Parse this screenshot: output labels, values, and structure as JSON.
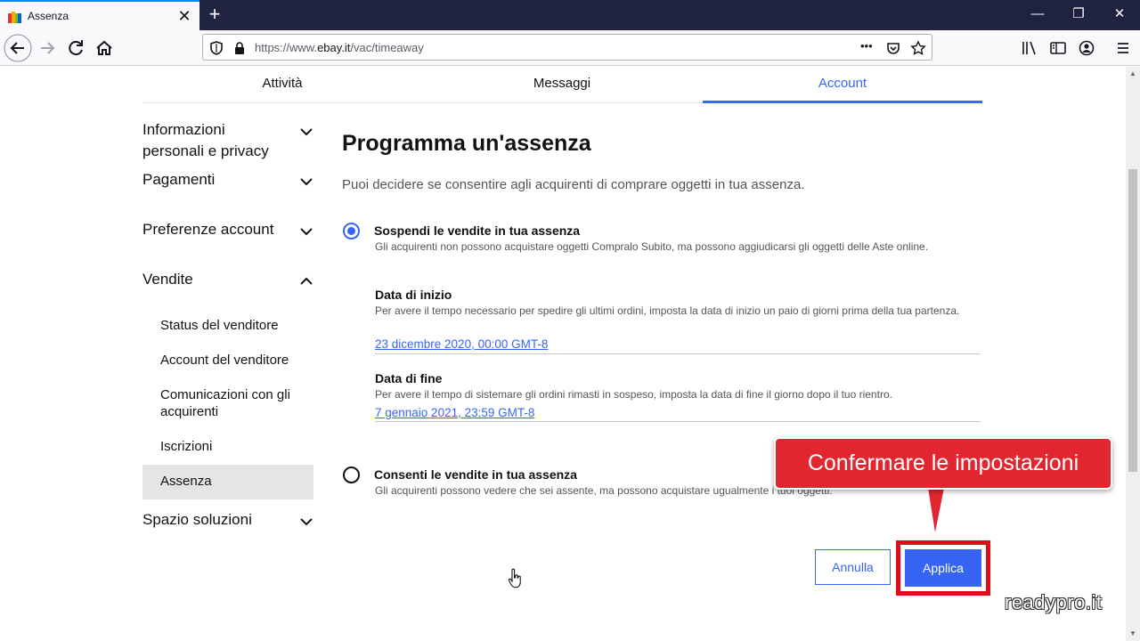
{
  "browser": {
    "tab_title": "Assenza",
    "tab_close": "✕",
    "new_tab": "+",
    "url_prefix": "https://www.",
    "url_domain": "ebay.it",
    "url_path": "/vac/timeaway",
    "url_more": "•••",
    "window_minimize": "—",
    "window_restore": "❐",
    "window_close": "✕",
    "icons": [
      "back-icon",
      "forward-icon",
      "reload-icon",
      "home-icon",
      "shield-icon",
      "lock-icon",
      "pocket-icon",
      "bookmark-star-icon",
      "library-icon",
      "sidebar-icon",
      "account-icon",
      "menu-icon"
    ]
  },
  "top_tabs": [
    {
      "label": "Attività",
      "active": false
    },
    {
      "label": "Messaggi",
      "active": false
    },
    {
      "label": "Account",
      "active": true
    }
  ],
  "sidebar": {
    "sections": [
      {
        "label": "Informazioni personali e privacy",
        "expanded": false
      },
      {
        "label": "Pagamenti",
        "expanded": false
      },
      {
        "label": "Preferenze account",
        "expanded": false
      },
      {
        "label": "Vendite",
        "expanded": true
      },
      {
        "label": "Spazio soluzioni",
        "expanded": false
      }
    ],
    "sales_items": [
      {
        "label": "Status del venditore",
        "active": false
      },
      {
        "label": "Account del venditore",
        "active": false
      },
      {
        "label": "Comunicazioni con gli acquirenti",
        "active": false
      },
      {
        "label": "Iscrizioni",
        "active": false
      },
      {
        "label": "Assenza",
        "active": true
      }
    ]
  },
  "main": {
    "title": "Programma un'assenza",
    "intro": "Puoi decidere se consentire agli acquirenti di comprare oggetti in tua assenza.",
    "option_suspend": {
      "title": "Sospendi le vendite in tua assenza",
      "description": "Gli acquirenti non possono acquistare oggetti Compralo Subito, ma possono aggiudicarsi gli oggetti delle Aste online.",
      "selected": true
    },
    "start_date": {
      "label": "Data di inizio",
      "help": "Per avere il tempo necessario per spedire gli ultimi ordini, imposta la data di inizio un paio di giorni prima della tua partenza.",
      "value": "23 dicembre 2020, 00:00 GMT-8"
    },
    "end_date": {
      "label": "Data di fine",
      "help": "Per avere il tempo di sistemare gli ordini rimasti in sospeso, imposta la data di fine il giorno dopo il tuo rientro.",
      "value": "7 gennaio 2021, 23:59 GMT-8"
    },
    "option_allow": {
      "title": "Consenti le vendite in tua assenza",
      "description": "Gli acquirenti possono vedere che sei assente, ma possono acquistare ugualmente i tuoi oggetti.",
      "selected": false
    },
    "cancel_label": "Annulla",
    "apply_label": "Applica"
  },
  "annotation": {
    "callout_text": "Confermare le impostazioni",
    "watermark": "readypro.it"
  },
  "colors": {
    "accent": "#3665f3",
    "callout": "#e1262f",
    "highlight_frame": "#e00c1c",
    "tabbar": "#202340"
  }
}
